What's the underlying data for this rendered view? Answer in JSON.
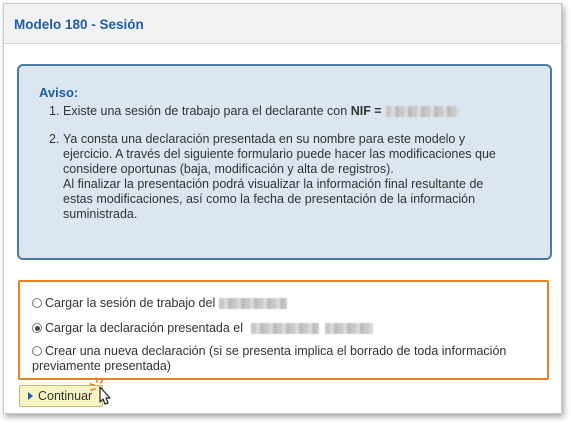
{
  "window": {
    "title": "Modelo 180 - Sesión"
  },
  "notice": {
    "title": "Aviso:",
    "items": [
      {
        "num": "1.",
        "text": "Existe una sesión de trabajo para el declarante con ",
        "bold": "NIF ="
      },
      {
        "num": "2.",
        "lines": [
          "Ya consta una declaración presentada en su nombre para este modelo y",
          "ejercicio. A través del siguiente formulario puede hacer las modificaciones que",
          "considere oportunas (baja, modificación y alta de registros).",
          "Al finalizar la presentación podrá visualizar la información final resultante de",
          "estas modificaciones, así como la fecha de presentación de la información",
          "suministrada."
        ]
      }
    ]
  },
  "options": [
    {
      "label": "Cargar la sesión de trabajo del",
      "checked": false
    },
    {
      "label": "Cargar la declaración presentada el",
      "checked": true
    },
    {
      "label": "Crear una nueva declaración (si se presenta implica el borrado de toda información",
      "label_line2": "previamente presentada)",
      "checked": false
    }
  ],
  "continue_button": {
    "label": "Continuar"
  },
  "colors": {
    "title": "#1f5ea6",
    "notice_bg": "#dbe6f1",
    "notice_border": "#4a7aab",
    "highlight_border": "#e8801f",
    "button_bg": "#f7f4c4"
  },
  "icons": {
    "cursor": "hand-pointer-icon",
    "button_arrow": "triangle-right-icon"
  }
}
